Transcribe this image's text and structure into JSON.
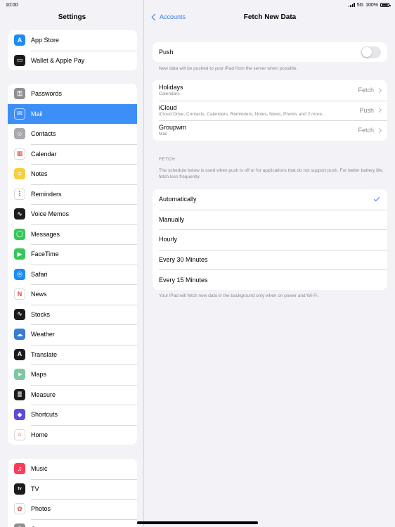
{
  "status": {
    "time": "10:00",
    "network": "5G",
    "battery": "100%"
  },
  "sidebar": {
    "title": "Settings",
    "groups": [
      [
        {
          "label": "App Store",
          "icon": "app-store-icon",
          "color": "#1a8cf5",
          "glyph": "A"
        },
        {
          "label": "Wallet & Apple Pay",
          "icon": "wallet-icon",
          "color": "#1c1c1e",
          "glyph": "▭"
        }
      ],
      [
        {
          "label": "Passwords",
          "icon": "key-icon",
          "color": "#8e8e93",
          "glyph": "⚿"
        },
        {
          "label": "Mail",
          "icon": "mail-icon",
          "color": "#3e8ef7",
          "glyph": "✉",
          "selected": true
        },
        {
          "label": "Contacts",
          "icon": "contacts-icon",
          "color": "#a8a8ad",
          "glyph": "☺"
        },
        {
          "label": "Calendar",
          "icon": "calendar-icon",
          "color": "#ffffff",
          "glyph": "▦"
        },
        {
          "label": "Notes",
          "icon": "notes-icon",
          "color": "#f7cf3c",
          "glyph": "≡"
        },
        {
          "label": "Reminders",
          "icon": "reminders-icon",
          "color": "#ffffff",
          "glyph": "⋮"
        },
        {
          "label": "Voice Memos",
          "icon": "voice-memos-icon",
          "color": "#1c1c1e",
          "glyph": "∿"
        },
        {
          "label": "Messages",
          "icon": "messages-icon",
          "color": "#34c759",
          "glyph": "◯"
        },
        {
          "label": "FaceTime",
          "icon": "facetime-icon",
          "color": "#34c759",
          "glyph": "▶"
        },
        {
          "label": "Safari",
          "icon": "safari-icon",
          "color": "#1a8cf5",
          "glyph": "◎"
        },
        {
          "label": "News",
          "icon": "news-icon",
          "color": "#ffffff",
          "glyph": "N"
        },
        {
          "label": "Stocks",
          "icon": "stocks-icon",
          "color": "#1c1c1e",
          "glyph": "∿"
        },
        {
          "label": "Weather",
          "icon": "weather-icon",
          "color": "#3a7bd5",
          "glyph": "☁"
        },
        {
          "label": "Translate",
          "icon": "translate-icon",
          "color": "#1c1c1e",
          "glyph": "A"
        },
        {
          "label": "Maps",
          "icon": "maps-icon",
          "color": "#7fc7a3",
          "glyph": "➤"
        },
        {
          "label": "Measure",
          "icon": "measure-icon",
          "color": "#1c1c1e",
          "glyph": "≣"
        },
        {
          "label": "Shortcuts",
          "icon": "shortcuts-icon",
          "color": "#5b4bd6",
          "glyph": "◆"
        },
        {
          "label": "Home",
          "icon": "home-icon",
          "color": "#ffffff",
          "glyph": "⌂"
        }
      ],
      [
        {
          "label": "Music",
          "icon": "music-icon",
          "color": "#fa3c5a",
          "glyph": "♫"
        },
        {
          "label": "TV",
          "icon": "tv-icon",
          "color": "#1c1c1e",
          "glyph": "tv"
        },
        {
          "label": "Photos",
          "icon": "photos-icon",
          "color": "#ffffff",
          "glyph": "✿"
        },
        {
          "label": "Camera",
          "icon": "camera-icon",
          "color": "#8e8e93",
          "glyph": "◉"
        }
      ]
    ]
  },
  "nav": {
    "back_label": "Accounts",
    "title": "Fetch New Data"
  },
  "push": {
    "label": "Push",
    "enabled": false,
    "note": "New data will be pushed to your iPad from the server when possible."
  },
  "accounts": [
    {
      "name": "Holidays",
      "detail": "Calendars",
      "value": "Fetch"
    },
    {
      "name": "iCloud",
      "detail": "iCloud Drive, Contacts, Calendars, Reminders, Notes, News, Photos and 2 more...",
      "value": "Push"
    },
    {
      "name": "Groupwm",
      "detail": "Mail",
      "value": "Fetch"
    }
  ],
  "fetch": {
    "section_label": "FETCH",
    "description": "The schedule below is used when push is off or for applications that do not support push. For better battery life, fetch less frequently.",
    "options": [
      {
        "label": "Automatically",
        "selected": true
      },
      {
        "label": "Manually",
        "selected": false
      },
      {
        "label": "Hourly",
        "selected": false
      },
      {
        "label": "Every 30 Minutes",
        "selected": false
      },
      {
        "label": "Every 15 Minutes",
        "selected": false
      }
    ],
    "footer": "Your iPad will fetch new data in the background only when on power and Wi-Fi."
  }
}
